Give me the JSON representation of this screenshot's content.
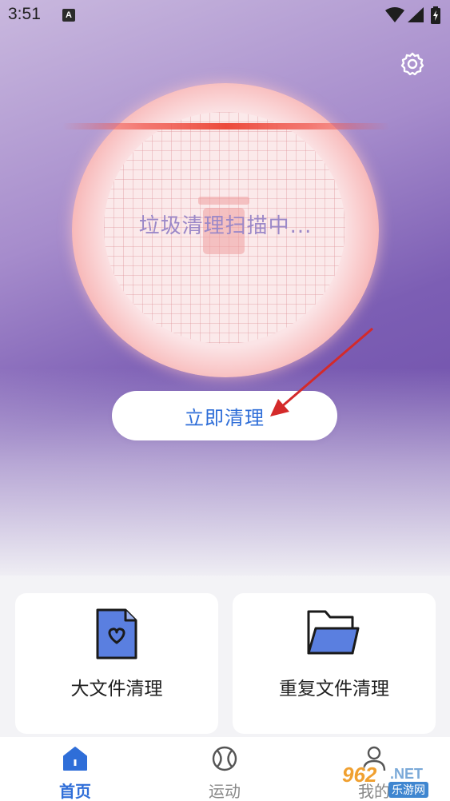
{
  "status_bar": {
    "time": "3:51",
    "notification_glyph": "A",
    "icons": [
      "wifi-icon",
      "signal-icon",
      "battery-icon"
    ]
  },
  "header": {
    "settings_icon": "gear-icon"
  },
  "scanner": {
    "status_text": "垃圾清理扫描中...",
    "icon": "trash-icon",
    "colors": {
      "ring": "#f39a96",
      "scan_line": "#ec4a3c",
      "text": "#9b88c8"
    }
  },
  "actions": {
    "clean_now_label": "立即清理"
  },
  "cards": [
    {
      "label": "大文件清理",
      "icon": "heart-file-icon"
    },
    {
      "label": "重复文件清理",
      "icon": "folder-icon"
    }
  ],
  "bottom_nav": {
    "items": [
      {
        "label": "首页",
        "icon": "home-icon",
        "active": true
      },
      {
        "label": "运动",
        "icon": "ball-icon",
        "active": false
      },
      {
        "label": "我的",
        "icon": "user-icon",
        "active": false
      }
    ]
  },
  "watermark": {
    "logo": "962",
    "net": ".NET",
    "sub": "乐游网"
  },
  "colors": {
    "accent": "#2f6ed8",
    "hero_top": "#c9b8de",
    "hero_bottom": "#6a4aa6"
  }
}
